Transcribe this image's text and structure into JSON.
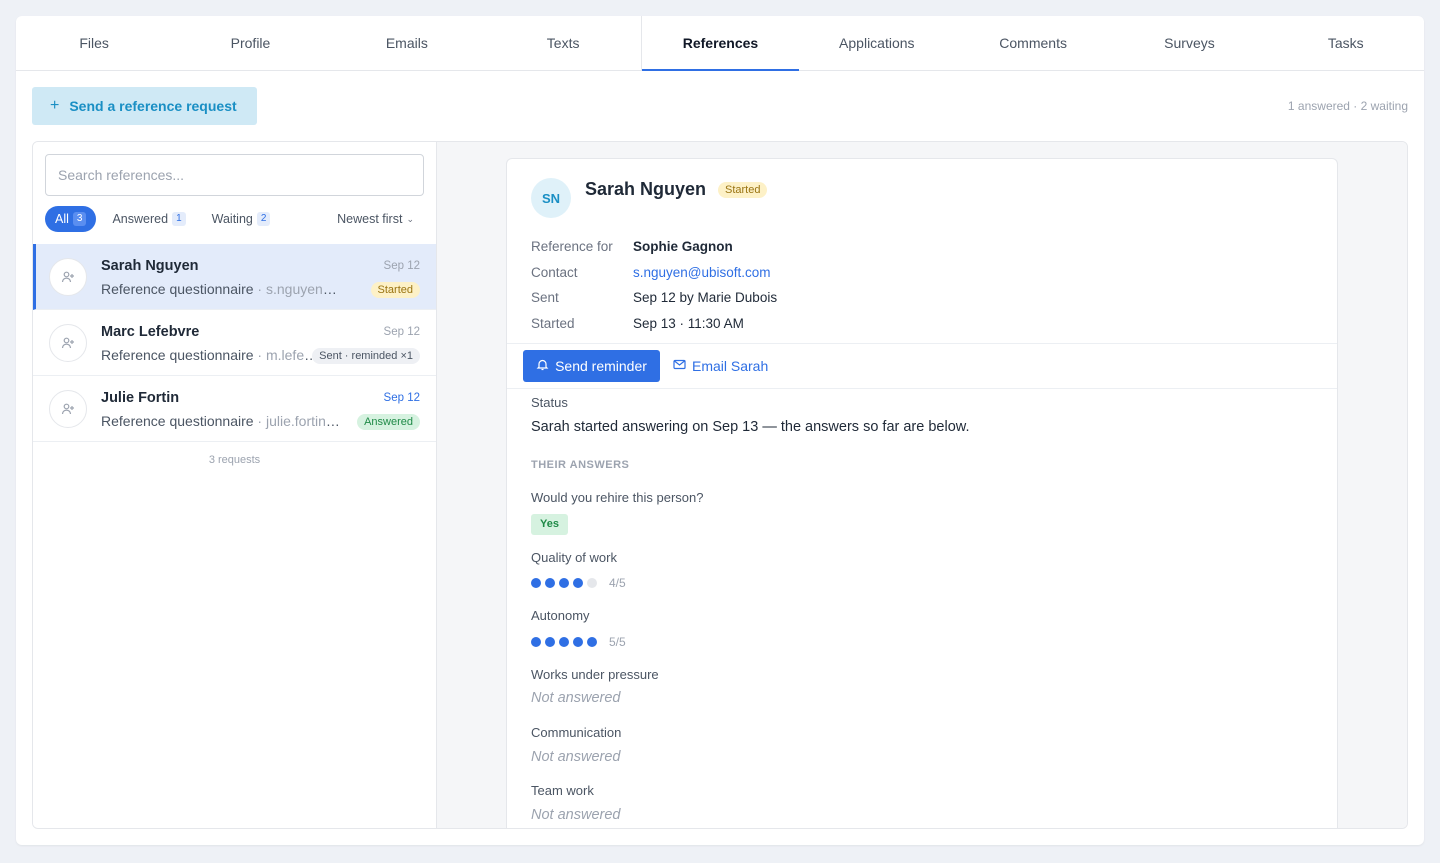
{
  "tabs": [
    {
      "label": "Files"
    },
    {
      "label": "Profile"
    },
    {
      "label": "Emails"
    },
    {
      "label": "Texts"
    },
    {
      "label": "References"
    },
    {
      "label": "Applications"
    },
    {
      "label": "Comments"
    },
    {
      "label": "Surveys"
    },
    {
      "label": "Tasks"
    }
  ],
  "active_tab": "References",
  "toolbar": {
    "send_request_label": "Send a reference request",
    "counts_text": "1 answered · 2 waiting"
  },
  "search": {
    "placeholder": "Search references..."
  },
  "filters": {
    "all": {
      "label": "All",
      "count": "3"
    },
    "answered": {
      "label": "Answered",
      "count": "1"
    },
    "waiting": {
      "label": "Waiting",
      "count": "2"
    },
    "sort": "Newest first"
  },
  "references": [
    {
      "name": "Sarah Nguyen",
      "date": "Sep 12",
      "type": "Reference questionnaire",
      "email": " · s.nguyen@ubisoft.com",
      "status": "Started"
    },
    {
      "name": "Marc Lefebvre",
      "date": "Sep 12",
      "type": "Reference questionnaire",
      "email": " · m.lefebvre@ubisoft.com",
      "status": "Sent · reminded ×1"
    },
    {
      "name": "Julie Fortin",
      "date": "Sep 12",
      "type": "Reference questionnaire",
      "email": " · julie.fortin@ubisoft.com",
      "status": "Answered"
    }
  ],
  "list_footer": "3 requests",
  "detail": {
    "initials": "SN",
    "name": "Sarah Nguyen",
    "status": "Started",
    "meta": [
      {
        "key": "Reference for",
        "value": "Sophie Gagnon"
      },
      {
        "key": "Contact",
        "value": "s.nguyen@ubisoft.com"
      },
      {
        "key": "Sent",
        "value": "Sep 12 by Marie Dubois"
      },
      {
        "key": "Started",
        "value": "Sep 13 · 11:30 AM"
      }
    ],
    "send_reminder_label": "Send reminder",
    "email_label": "Email Sarah",
    "status_label": "Status",
    "status_text": "Sarah started answering on Sep 13 — the answers so far are below.",
    "answers_heading": "THEIR ANSWERS",
    "answers": [
      {
        "question": "Would you rehire this person?",
        "answer": "Yes"
      },
      {
        "question": "Quality of work",
        "rating": 4,
        "max": 5,
        "rating_text": "4/5"
      },
      {
        "question": "Autonomy",
        "rating": 5,
        "max": 5,
        "rating_text": "5/5"
      },
      {
        "question": "Works under pressure",
        "answer": "Not answered"
      },
      {
        "question": "Communication",
        "answer": "Not answered"
      },
      {
        "question": "Team work",
        "answer": "Not answered"
      }
    ]
  },
  "colors": {
    "accent": "#2f6fe4",
    "started": "#fdf1c7",
    "answered": "#d6f2e0",
    "send_btn_bg": "#cfe9f5"
  }
}
